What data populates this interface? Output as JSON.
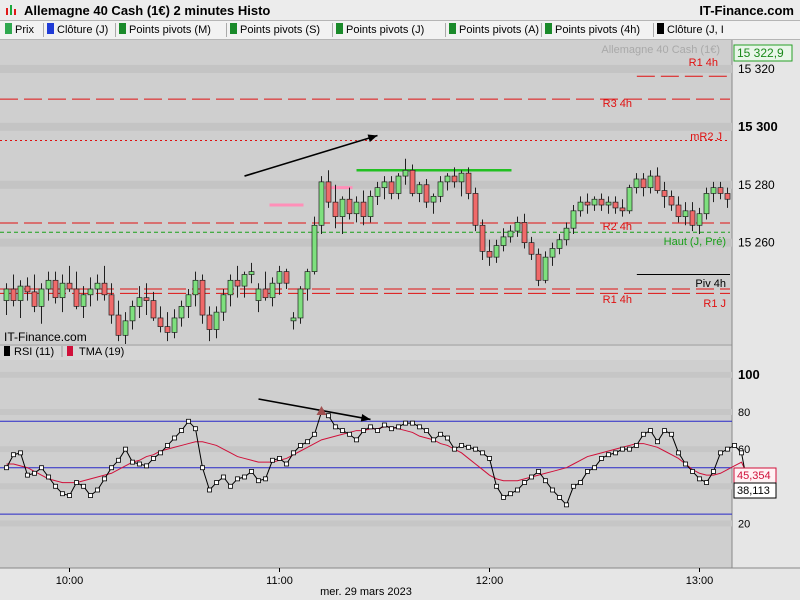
{
  "window": {
    "title": "Allemagne 40 Cash (1€) 2 minutes Histo",
    "site": "IT-Finance.com"
  },
  "legend": [
    {
      "label": "Prix",
      "color": "#2fa84f"
    },
    {
      "label": "Clôture (J)",
      "color": "#1f3bd6"
    },
    {
      "label": "Points pivots (M)",
      "color": "#1a8a2a"
    },
    {
      "label": "Points pivots (S)",
      "color": "#1a8a2a"
    },
    {
      "label": "Points pivots (J)",
      "color": "#1a8a2a"
    },
    {
      "label": "Points pivots (A)",
      "color": "#1a8a2a"
    },
    {
      "label": "Points pivots (4h)",
      "color": "#1a8a2a"
    },
    {
      "label": "Clôture (J, I",
      "color": "#000000"
    }
  ],
  "price_panel": {
    "instrument_label": "Allemagne 40 Cash (1€)",
    "watermark": "IT-Finance.com",
    "last_price": "15 322,9",
    "y_ticks": [
      "15 320",
      "15 300",
      "15 280",
      "15 260"
    ],
    "levels": [
      {
        "label": "R1 4h",
        "value": 15317.5,
        "color": "#e01010",
        "style": "long-dash",
        "from": 0.87
      },
      {
        "label": "R3 4h",
        "value": 15309.6,
        "color": "#e01010",
        "style": "long-dash",
        "from": 0.0
      },
      {
        "label": "mR2 J",
        "value": 15295.3,
        "color": "#e01010",
        "style": "dotted",
        "from": 0.0
      },
      {
        "label": "R2 4h",
        "value": 15266.8,
        "color": "#e01010",
        "style": "long-dash",
        "from": 0.0
      },
      {
        "label": "Haut (J, Pré)",
        "value": 15263.6,
        "color": "#18a018",
        "style": "short-dash",
        "from": 0.0
      },
      {
        "label": "Piv 4h",
        "value": 15249.0,
        "color": "#000000",
        "style": "solid",
        "from": 0.87
      },
      {
        "label": "R1 4h",
        "value": 15244.0,
        "color": "#e01010",
        "style": "long-dash",
        "from": 0.0
      },
      {
        "label": "R1 J",
        "value": 15242.5,
        "color": "#e01010",
        "style": "long-dash",
        "from": 0.0
      }
    ]
  },
  "rsi_panel": {
    "legend_rsi": "RSI (11)",
    "legend_tma": "TMA (19)",
    "rsi_color": "#000000",
    "tma_color": "#d0103a",
    "y_ticks": [
      "100",
      "80",
      "60",
      "40",
      "20"
    ],
    "bands": [
      75,
      50,
      25
    ],
    "rsi_value": "38,113",
    "tma_value": "45,354"
  },
  "x_axis": {
    "date_label": "mer. 29 mars 2023",
    "time_ticks": [
      "10:00",
      "11:00",
      "12:00",
      "13:00"
    ]
  },
  "chart_data": {
    "type": "candlestick",
    "x_start": "09:42",
    "interval_minutes": 2,
    "ylim": [
      15225,
      15330
    ],
    "candles": [
      [
        15240,
        15246,
        15235,
        15244
      ],
      [
        15244,
        15249,
        15238,
        15240
      ],
      [
        15240,
        15247,
        15234,
        15245
      ],
      [
        15245,
        15248,
        15240,
        15243
      ],
      [
        15243,
        15249,
        15236,
        15238
      ],
      [
        15238,
        15246,
        15232,
        15244
      ],
      [
        15244,
        15250,
        15240,
        15247
      ],
      [
        15247,
        15250,
        15239,
        15241
      ],
      [
        15241,
        15249,
        15236,
        15246
      ],
      [
        15246,
        15252,
        15243,
        15244
      ],
      [
        15244,
        15250,
        15237,
        15238
      ],
      [
        15238,
        15245,
        15234,
        15242
      ],
      [
        15242,
        15248,
        15238,
        15244
      ],
      [
        15244,
        15249,
        15240,
        15246
      ],
      [
        15246,
        15252,
        15240,
        15242
      ],
      [
        15242,
        15246,
        15232,
        15235
      ],
      [
        15235,
        15240,
        15226,
        15228
      ],
      [
        15228,
        15236,
        15225,
        15233
      ],
      [
        15233,
        15240,
        15230,
        15238
      ],
      [
        15238,
        15245,
        15234,
        15241
      ],
      [
        15241,
        15246,
        15235,
        15240
      ],
      [
        15240,
        15243,
        15233,
        15234
      ],
      [
        15234,
        15238,
        15229,
        15231
      ],
      [
        15231,
        15236,
        15226,
        15229
      ],
      [
        15229,
        15237,
        15227,
        15234
      ],
      [
        15234,
        15240,
        15231,
        15238
      ],
      [
        15238,
        15244,
        15234,
        15242
      ],
      [
        15242,
        15250,
        15238,
        15247
      ],
      [
        15247,
        15249,
        15232,
        15235
      ],
      [
        15235,
        15238,
        15226,
        15230
      ],
      [
        15230,
        15238,
        15227,
        15236
      ],
      [
        15236,
        15244,
        15233,
        15242
      ],
      [
        15242,
        15249,
        15238,
        15247
      ],
      [
        15247,
        15252,
        15241,
        15245
      ],
      [
        15245,
        15250,
        15241,
        15249
      ],
      [
        15249,
        15253,
        15246,
        15250
      ],
      [
        15240,
        15246,
        15236,
        15244
      ],
      [
        15244,
        15250,
        15240,
        15241
      ],
      [
        15241,
        15248,
        15238,
        15246
      ],
      [
        15246,
        15252,
        15242,
        15250
      ],
      [
        15250,
        15251,
        15244,
        15246
      ],
      [
        15233,
        15236,
        15230,
        15234
      ],
      [
        15234,
        15245,
        15232,
        15244
      ],
      [
        15244,
        15251,
        15240,
        15250
      ],
      [
        15250,
        15269,
        15249,
        15266
      ],
      [
        15266,
        15283,
        15263,
        15281
      ],
      [
        15281,
        15285,
        15272,
        15274
      ],
      [
        15274,
        15280,
        15265,
        15269
      ],
      [
        15269,
        15276,
        15263,
        15275
      ],
      [
        15275,
        15279,
        15268,
        15270
      ],
      [
        15270,
        15276,
        15267,
        15274
      ],
      [
        15274,
        15278,
        15266,
        15269
      ],
      [
        15269,
        15278,
        15267,
        15276
      ],
      [
        15276,
        15281,
        15273,
        15279
      ],
      [
        15279,
        15283,
        15275,
        15281
      ],
      [
        15281,
        15283,
        15275,
        15277
      ],
      [
        15277,
        15284,
        15275,
        15283
      ],
      [
        15283,
        15289,
        15280,
        15285
      ],
      [
        15285,
        15287,
        15276,
        15277
      ],
      [
        15277,
        15281,
        15274,
        15280
      ],
      [
        15280,
        15282,
        15272,
        15274
      ],
      [
        15274,
        15277,
        15270,
        15276
      ],
      [
        15276,
        15283,
        15274,
        15281
      ],
      [
        15281,
        15284,
        15278,
        15283
      ],
      [
        15283,
        15286,
        15279,
        15281
      ],
      [
        15281,
        15285,
        15276,
        15284
      ],
      [
        15284,
        15286,
        15275,
        15277
      ],
      [
        15277,
        15279,
        15264,
        15266
      ],
      [
        15266,
        15268,
        15254,
        15257
      ],
      [
        15257,
        15261,
        15252,
        15255
      ],
      [
        15255,
        15261,
        15253,
        15259
      ],
      [
        15259,
        15265,
        15257,
        15262
      ],
      [
        15262,
        15266,
        15260,
        15264
      ],
      [
        15264,
        15269,
        15262,
        15267
      ],
      [
        15267,
        15270,
        15258,
        15260
      ],
      [
        15260,
        15262,
        15254,
        15256
      ],
      [
        15256,
        15258,
        15245,
        15247
      ],
      [
        15247,
        15257,
        15246,
        15255
      ],
      [
        15255,
        15260,
        15252,
        15258
      ],
      [
        15258,
        15263,
        15256,
        15261
      ],
      [
        15261,
        15267,
        15259,
        15265
      ],
      [
        15265,
        15273,
        15263,
        15271
      ],
      [
        15271,
        15276,
        15269,
        15274
      ],
      [
        15274,
        15277,
        15270,
        15273
      ],
      [
        15273,
        15276,
        15271,
        15275
      ],
      [
        15275,
        15277,
        15271,
        15273
      ],
      [
        15273,
        15276,
        15270,
        15274
      ],
      [
        15274,
        15276,
        15270,
        15272
      ],
      [
        15272,
        15275,
        15269,
        15271
      ],
      [
        15271,
        15280,
        15270,
        15279
      ],
      [
        15279,
        15284,
        15277,
        15282
      ],
      [
        15282,
        15284,
        15276,
        15279
      ],
      [
        15279,
        15285,
        15277,
        15283
      ],
      [
        15283,
        15286,
        15277,
        15278
      ],
      [
        15278,
        15281,
        15272,
        15276
      ],
      [
        15276,
        15278,
        15271,
        15273
      ],
      [
        15273,
        15276,
        15267,
        15269
      ],
      [
        15269,
        15274,
        15266,
        15271
      ],
      [
        15271,
        15274,
        15264,
        15266
      ],
      [
        15266,
        15272,
        15263,
        15270
      ],
      [
        15270,
        15279,
        15268,
        15277
      ],
      [
        15277,
        15281,
        15274,
        15279
      ],
      [
        15279,
        15281,
        15275,
        15277
      ],
      [
        15277,
        15279,
        15272,
        15275
      ]
    ],
    "rsi": [
      50,
      57,
      58,
      46,
      47,
      50,
      45,
      40,
      36,
      35,
      42,
      40,
      35,
      38,
      44,
      50,
      54,
      60,
      53,
      52,
      51,
      55,
      58,
      62,
      66,
      70,
      75,
      71,
      50,
      38,
      42,
      45,
      40,
      44,
      45,
      48,
      43,
      44,
      54,
      55,
      52,
      58,
      62,
      64,
      68,
      80,
      78,
      72,
      70,
      68,
      65,
      70,
      72,
      70,
      73,
      71,
      72,
      74,
      74,
      72,
      70,
      65,
      68,
      66,
      60,
      62,
      61,
      60,
      58,
      55,
      40,
      34,
      36,
      38,
      42,
      45,
      48,
      43,
      38,
      34,
      30,
      40,
      42,
      48,
      50,
      55,
      57,
      58,
      60,
      60,
      62,
      68,
      70,
      64,
      70,
      68,
      58,
      52,
      48,
      44,
      42,
      48,
      58,
      60,
      62,
      58,
      38
    ],
    "tma": [
      52,
      52,
      51,
      50,
      48,
      46,
      44,
      43,
      42,
      42,
      42,
      43,
      44,
      45,
      46,
      47,
      49,
      51,
      53,
      54,
      56,
      57,
      59,
      60,
      61,
      62,
      63,
      64,
      64,
      63,
      62,
      60,
      58,
      56,
      55,
      54,
      53,
      53,
      53,
      54,
      55,
      57,
      59,
      61,
      63,
      65,
      66,
      67,
      68,
      69,
      70,
      70,
      71,
      71,
      72,
      72,
      71,
      70,
      69,
      67,
      66,
      65,
      63,
      62,
      60,
      58,
      55,
      52,
      49,
      46,
      44,
      43,
      43,
      43,
      44,
      45,
      46,
      47,
      48,
      49,
      50,
      52,
      54,
      56,
      57,
      58,
      59,
      60,
      61,
      62,
      63,
      63,
      62,
      61,
      59,
      57,
      55,
      52,
      49,
      47,
      46,
      46,
      47,
      49,
      51,
      53,
      45
    ],
    "pink_levels": [
      {
        "from": 38,
        "to": 42,
        "value": 15273
      },
      {
        "from": 45,
        "to": 49,
        "value": 15279
      }
    ],
    "green_segment": {
      "from": 50,
      "to": 71,
      "value": 15285
    },
    "annotations": [
      {
        "panel": "price",
        "kind": "arrow",
        "from": [
          34,
          15283
        ],
        "to": [
          53,
          15297
        ]
      },
      {
        "panel": "rsi",
        "kind": "arrow",
        "from": [
          36,
          87
        ],
        "to": [
          52,
          76
        ]
      }
    ]
  }
}
